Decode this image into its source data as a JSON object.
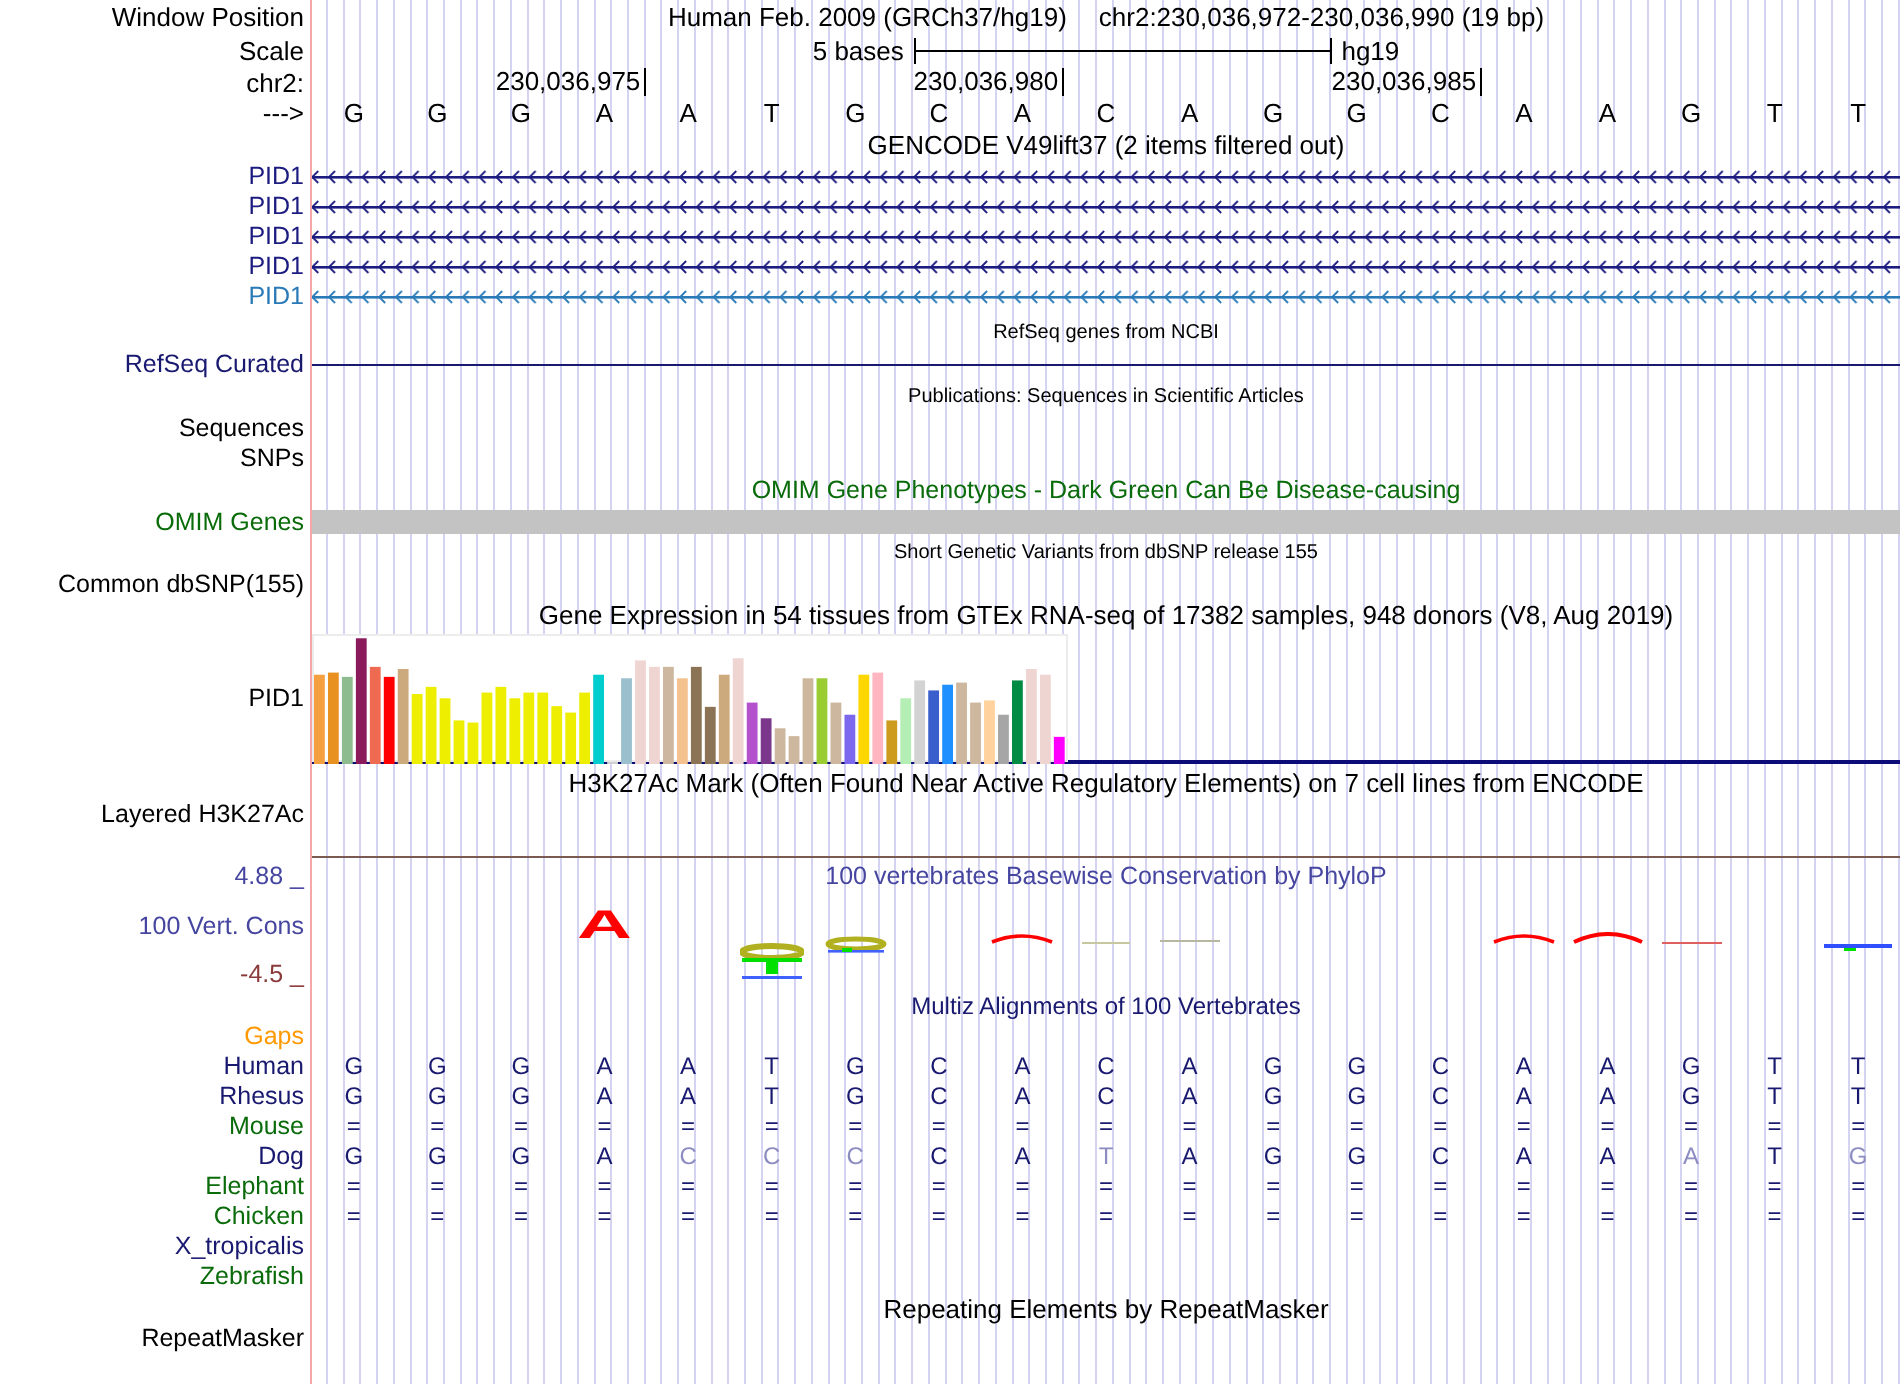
{
  "header": {
    "window_position_label": "Window Position",
    "assembly": "Human Feb. 2009 (GRCh37/hg19)",
    "position": "chr2:230,036,972-230,036,990 (19 bp)"
  },
  "scale": {
    "label": "Scale",
    "bar_label": "5 bases",
    "database": "hg19"
  },
  "ruler": {
    "label": "chr2:",
    "ticks": [
      "230,036,975",
      "230,036,980",
      "230,036,985"
    ]
  },
  "sequence": {
    "label": "--->",
    "bases": [
      "G",
      "G",
      "G",
      "A",
      "A",
      "T",
      "G",
      "C",
      "A",
      "C",
      "A",
      "G",
      "G",
      "C",
      "A",
      "A",
      "G",
      "T",
      "T"
    ]
  },
  "tracks": [
    {
      "kind": "genes",
      "title": "GENCODE V49lift37 (2 items filtered out)",
      "items": [
        {
          "label": "PID1",
          "color": "#1c1c80"
        },
        {
          "label": "PID1",
          "color": "#1c1c80"
        },
        {
          "label": "PID1",
          "color": "#1c1c80"
        },
        {
          "label": "PID1",
          "color": "#1c1c80"
        },
        {
          "label": "PID1",
          "color": "#2a7ab8"
        }
      ]
    },
    {
      "kind": "refseq",
      "title": "RefSeq genes from NCBI",
      "labels": [
        "RefSeq Curated"
      ]
    },
    {
      "kind": "publications",
      "title": "Publications: Sequences in Scientific Articles",
      "labels": [
        "Sequences",
        "SNPs"
      ]
    },
    {
      "kind": "omim",
      "title": "OMIM Gene Phenotypes - Dark Green Can Be Disease-causing",
      "labels": [
        "OMIM Genes"
      ]
    },
    {
      "kind": "dbsnp",
      "title": "Short Genetic Variants from dbSNP release 155",
      "labels": [
        "Common dbSNP(155)"
      ]
    },
    {
      "kind": "gtex",
      "title": "Gene Expression in 54 tissues from GTEx RNA-seq of 17382 samples, 948 donors (V8, Aug 2019)",
      "labels": [
        "PID1"
      ]
    },
    {
      "kind": "chip",
      "title": "H3K27Ac Mark (Often Found Near Active Regulatory Elements) on 7 cell lines from ENCODE",
      "labels": [
        "Layered H3K27Ac"
      ]
    },
    {
      "kind": "phylop",
      "title": "100 vertebrates Basewise Conservation by PhyloP",
      "labels": [
        "4.88 _",
        "100 Vert. Cons",
        "-4.5 _"
      ],
      "logo_letter": "A"
    },
    {
      "kind": "multiz",
      "title": "Multiz Alignments of 100 Vertebrates",
      "species": [
        {
          "name": "Gaps",
          "color": "#ff9900"
        },
        {
          "name": "Human",
          "color": "#191970",
          "bases": [
            "G",
            "G",
            "G",
            "A",
            "A",
            "T",
            "G",
            "C",
            "A",
            "C",
            "A",
            "G",
            "G",
            "C",
            "A",
            "A",
            "G",
            "T",
            "T"
          ]
        },
        {
          "name": "Rhesus",
          "color": "#191970",
          "bases": [
            "G",
            "G",
            "G",
            "A",
            "A",
            "T",
            "G",
            "C",
            "A",
            "C",
            "A",
            "G",
            "G",
            "C",
            "A",
            "A",
            "G",
            "T",
            "T"
          ]
        },
        {
          "name": "Mouse",
          "color": "#0a6b0a",
          "bases": [
            "=",
            "=",
            "=",
            "=",
            "=",
            "=",
            "=",
            "=",
            "=",
            "=",
            "=",
            "=",
            "=",
            "=",
            "=",
            "=",
            "=",
            "=",
            "="
          ]
        },
        {
          "name": "Dog",
          "color": "#191970",
          "bases": [
            "G",
            "G",
            "G",
            "A",
            "C",
            "C",
            "C",
            "C",
            "A",
            "T",
            "A",
            "G",
            "G",
            "C",
            "A",
            "A",
            "A",
            "T",
            "G"
          ],
          "faded": [
            false,
            false,
            false,
            false,
            true,
            true,
            true,
            false,
            false,
            true,
            false,
            false,
            false,
            false,
            false,
            false,
            true,
            false,
            true
          ]
        },
        {
          "name": "Elephant",
          "color": "#0a6b0a",
          "bases": [
            "=",
            "=",
            "=",
            "=",
            "=",
            "=",
            "=",
            "=",
            "=",
            "=",
            "=",
            "=",
            "=",
            "=",
            "=",
            "=",
            "=",
            "=",
            "="
          ]
        },
        {
          "name": "Chicken",
          "color": "#0a6b0a",
          "bases": [
            "=",
            "=",
            "=",
            "=",
            "=",
            "=",
            "=",
            "=",
            "=",
            "=",
            "=",
            "=",
            "=",
            "=",
            "=",
            "=",
            "=",
            "=",
            "="
          ]
        },
        {
          "name": "X_tropicalis",
          "color": "#191970"
        },
        {
          "name": "Zebrafish",
          "color": "#0a6b0a"
        }
      ]
    },
    {
      "kind": "repeats",
      "title": "Repeating Elements by RepeatMasker",
      "labels": [
        "RepeatMasker"
      ]
    }
  ]
}
